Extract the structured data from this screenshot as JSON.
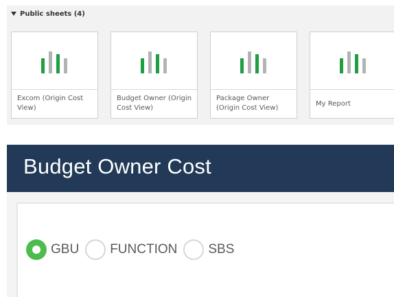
{
  "public_sheets": {
    "header": "Public sheets (4)",
    "cards": [
      {
        "title": "Excom (Origin Cost View)"
      },
      {
        "title": "Budget Owner (Origin Cost View)"
      },
      {
        "title": "Package Owner (Origin Cost View)"
      },
      {
        "title": "My Report"
      }
    ],
    "thumbnail_icon": "bar-chart-icon",
    "thumbnail_colors": {
      "green": "#1f9e43",
      "gray": "#b3b3b3"
    }
  },
  "banner": {
    "title": "Budget Owner Cost",
    "background": "#223a57"
  },
  "filter": {
    "options": [
      {
        "label": "GBU",
        "selected": true
      },
      {
        "label": "FUNCTION",
        "selected": false
      },
      {
        "label": "SBS",
        "selected": false
      }
    ],
    "selected_color": "#4dbb4d"
  }
}
